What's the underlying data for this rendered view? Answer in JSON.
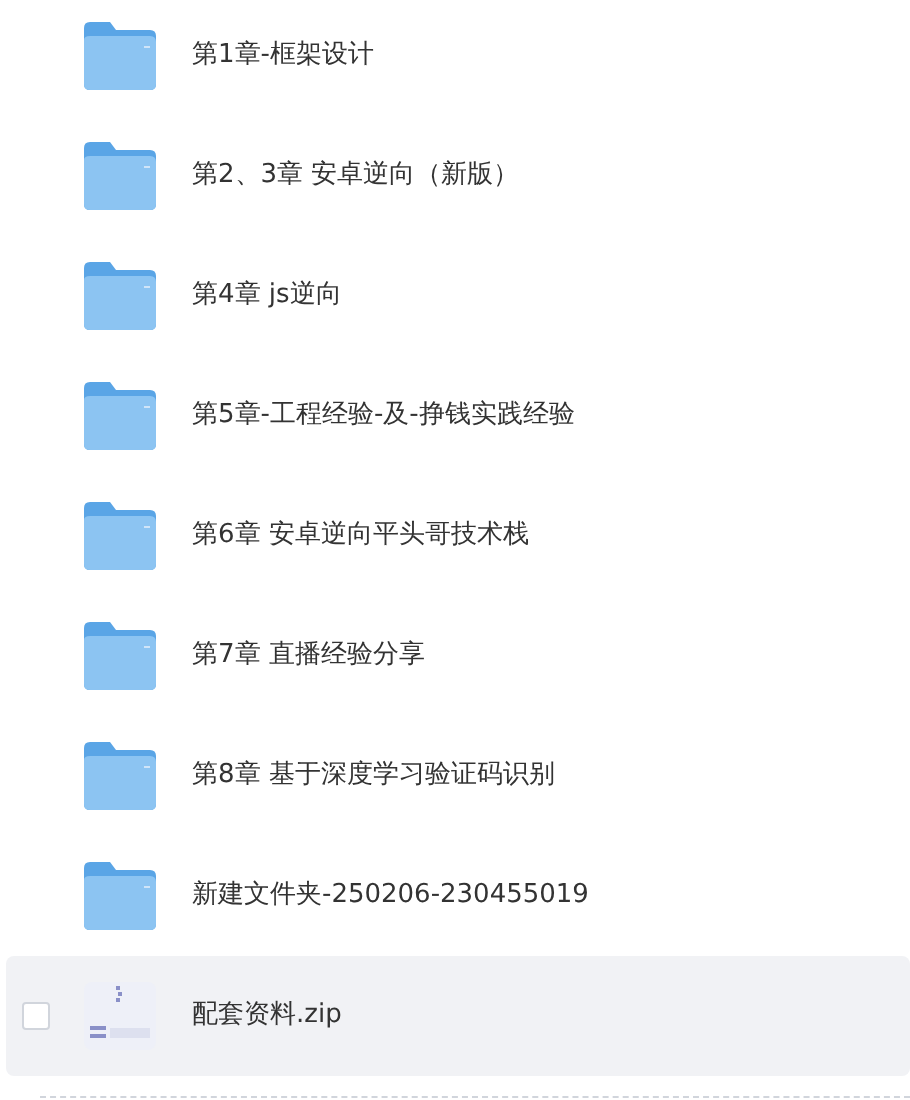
{
  "files": [
    {
      "kind": "folder",
      "name": "第1章-框架设计",
      "highlighted": false,
      "checked": false
    },
    {
      "kind": "folder",
      "name": "第2、3章 安卓逆向（新版）",
      "highlighted": false,
      "checked": false
    },
    {
      "kind": "folder",
      "name": "第4章 js逆向",
      "highlighted": false,
      "checked": false
    },
    {
      "kind": "folder",
      "name": "第5章-工程经验-及-挣钱实践经验",
      "highlighted": false,
      "checked": false
    },
    {
      "kind": "folder",
      "name": "第6章 安卓逆向平头哥技术栈",
      "highlighted": false,
      "checked": false
    },
    {
      "kind": "folder",
      "name": "第7章 直播经验分享",
      "highlighted": false,
      "checked": false
    },
    {
      "kind": "folder",
      "name": "第8章 基于深度学习验证码识别",
      "highlighted": false,
      "checked": false
    },
    {
      "kind": "folder",
      "name": "新建文件夹-250206-230455019",
      "highlighted": false,
      "checked": false
    },
    {
      "kind": "zip",
      "name": "配套资料.zip",
      "highlighted": true,
      "checked": false
    }
  ]
}
